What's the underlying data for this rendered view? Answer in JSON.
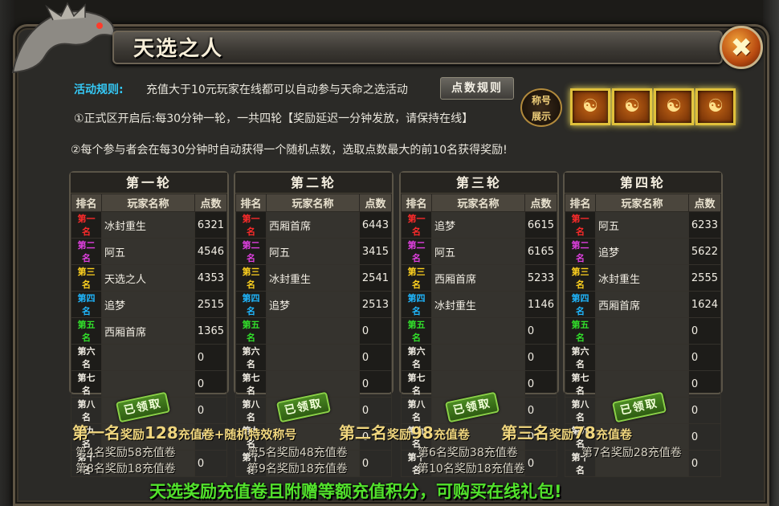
{
  "window": {
    "title": "天选之人",
    "close_glyph": "✖"
  },
  "rules": {
    "label": "活动规则:",
    "text": "充值大于10元玩家在线都可以自动参与天命之选活动",
    "points_button": "点数规则",
    "line1": "①正式区开启后:每30分钟一轮，一共四轮【奖励延迟一分钟发放，请保持在线】",
    "line2": "②每个参与者会在每30分钟时自动获得一个随机点数，选取点数最大的前10名获得奖励!"
  },
  "title_badge": {
    "line1": "称号",
    "line2": "展示"
  },
  "cards": [
    "card-icon",
    "card-icon",
    "card-icon",
    "card-icon"
  ],
  "table_headers": {
    "rank": "排名",
    "name": "玩家名称",
    "points": "点数"
  },
  "rank_colors": [
    "#ff2b2b",
    "#e040e0",
    "#ffd21f",
    "#1fb7ff",
    "#32e12b",
    "#f2eee4",
    "#f2eee4",
    "#f2eee4",
    "#f2eee4",
    "#f2eee4"
  ],
  "rounds": [
    {
      "title": "第一轮",
      "rows": [
        {
          "rank": "第一名",
          "name": "冰封重生",
          "points": "6321"
        },
        {
          "rank": "第二名",
          "name": "阿五",
          "points": "4546"
        },
        {
          "rank": "第三名",
          "name": "天选之人",
          "points": "4353"
        },
        {
          "rank": "第四名",
          "name": "追梦",
          "points": "2515"
        },
        {
          "rank": "第五名",
          "name": "西厢首席",
          "points": "1365"
        },
        {
          "rank": "第六名",
          "name": "",
          "points": "0"
        },
        {
          "rank": "第七名",
          "name": "",
          "points": "0"
        },
        {
          "rank": "第八名",
          "name": "",
          "points": "0"
        },
        {
          "rank": "第九名",
          "name": "",
          "points": "0"
        },
        {
          "rank": "第十名",
          "name": "",
          "points": "0"
        }
      ]
    },
    {
      "title": "第二轮",
      "rows": [
        {
          "rank": "第一名",
          "name": "西厢首席",
          "points": "6443"
        },
        {
          "rank": "第二名",
          "name": "阿五",
          "points": "3415"
        },
        {
          "rank": "第三名",
          "name": "冰封重生",
          "points": "2541"
        },
        {
          "rank": "第四名",
          "name": "追梦",
          "points": "2513"
        },
        {
          "rank": "第五名",
          "name": "",
          "points": "0"
        },
        {
          "rank": "第六名",
          "name": "",
          "points": "0"
        },
        {
          "rank": "第七名",
          "name": "",
          "points": "0"
        },
        {
          "rank": "第八名",
          "name": "",
          "points": "0"
        },
        {
          "rank": "第九名",
          "name": "",
          "points": "0"
        },
        {
          "rank": "第十名",
          "name": "",
          "points": "0"
        }
      ]
    },
    {
      "title": "第三轮",
      "rows": [
        {
          "rank": "第一名",
          "name": "追梦",
          "points": "6615"
        },
        {
          "rank": "第二名",
          "name": "阿五",
          "points": "6165"
        },
        {
          "rank": "第三名",
          "name": "西厢首席",
          "points": "5233"
        },
        {
          "rank": "第四名",
          "name": "冰封重生",
          "points": "1146"
        },
        {
          "rank": "第五名",
          "name": "",
          "points": "0"
        },
        {
          "rank": "第六名",
          "name": "",
          "points": "0"
        },
        {
          "rank": "第七名",
          "name": "",
          "points": "0"
        },
        {
          "rank": "第八名",
          "name": "",
          "points": "0"
        },
        {
          "rank": "第九名",
          "name": "",
          "points": "0"
        },
        {
          "rank": "第十名",
          "name": "",
          "points": "0"
        }
      ]
    },
    {
      "title": "第四轮",
      "rows": [
        {
          "rank": "第一名",
          "name": "阿五",
          "points": "6233"
        },
        {
          "rank": "第二名",
          "name": "追梦",
          "points": "5622"
        },
        {
          "rank": "第三名",
          "name": "冰封重生",
          "points": "2555"
        },
        {
          "rank": "第四名",
          "name": "西厢首席",
          "points": "1624"
        },
        {
          "rank": "第五名",
          "name": "",
          "points": "0"
        },
        {
          "rank": "第六名",
          "name": "",
          "points": "0"
        },
        {
          "rank": "第七名",
          "name": "",
          "points": "0"
        },
        {
          "rank": "第八名",
          "name": "",
          "points": "0"
        },
        {
          "rank": "第九名",
          "name": "",
          "points": "0"
        },
        {
          "rank": "第十名",
          "name": "",
          "points": "0"
        }
      ]
    }
  ],
  "claimed_label": "已领取",
  "rewards_big": [
    {
      "rank": "第一名",
      "mid": "奖励",
      "num": "128",
      "rest": "充值卷+随机特效称号"
    },
    {
      "rank": "第二名",
      "mid": "奖励",
      "num": "98",
      "rest": "充值卷"
    },
    {
      "rank": "第三名",
      "mid": "奖励",
      "num": "78",
      "rest": "充值卷"
    }
  ],
  "rewards_small": [
    "第4名奖励58充值卷",
    "第5名奖励48充值卷",
    "第6名奖励38充值卷",
    "第7名奖励28充值卷",
    "第8名奖励18充值卷",
    "第9名奖励18充值卷",
    "第10名奖励18充值卷"
  ],
  "footer": "天选奖励充值卷且附赠等额充值积分，可购买在线礼包!"
}
